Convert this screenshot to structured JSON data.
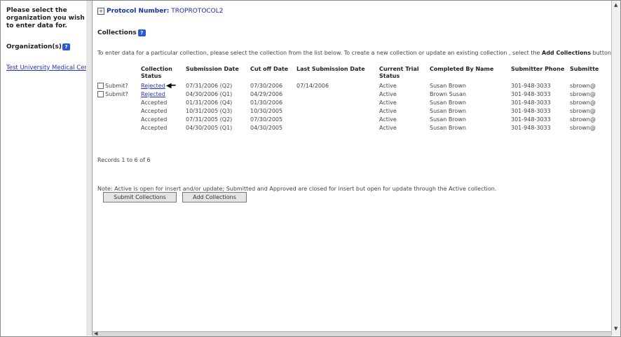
{
  "left": {
    "prompt": "Please select the organization you wish to enter data for.",
    "orgs_label": "Organization(s)",
    "org_link": "Test University Medical Cent"
  },
  "header": {
    "protocol_label": "Protocol Number:",
    "protocol_value": "TROPROTOCOL2",
    "collections_title": "Collections",
    "instructions_pre": "To enter data for a particular collection, please select the collection from the list below. To create a new collection or update an existing collection , select the",
    "instructions_bold": "Add Collections",
    "instructions_post": "button"
  },
  "table": {
    "headers": [
      "",
      "Collection Status",
      "Submission Date",
      "Cut off Date",
      "Last Submission Date",
      "Current Trial Status",
      "Completed By Name",
      "Submitter Phone",
      "Submitte"
    ],
    "rows": [
      {
        "submit": "Submit?",
        "status": "Rejected",
        "submission": "07/31/2006 (Q2)",
        "cutoff": "07/30/2006",
        "last": "07/14/2006",
        "trial": "Active",
        "completed": "Susan Brown",
        "phone": "301-948-3033",
        "email": "sbrown@"
      },
      {
        "submit": "Submit?",
        "status": "Rejected",
        "submission": "04/30/2006 (Q1)",
        "cutoff": "04/29/2006",
        "last": "",
        "trial": "Active",
        "completed": "Brown Susan",
        "phone": "301-948-3033",
        "email": "sbrown@"
      },
      {
        "submit": "",
        "status": "Accepted",
        "submission": "01/31/2006 (Q4)",
        "cutoff": "01/30/2006",
        "last": "",
        "trial": "Active",
        "completed": "Susan Brown",
        "phone": "301-948-3033",
        "email": "sbrown@"
      },
      {
        "submit": "",
        "status": "Accepted",
        "submission": "10/31/2005 (Q3)",
        "cutoff": "10/30/2005",
        "last": "",
        "trial": "Active",
        "completed": "Susan Brown",
        "phone": "301-948-3033",
        "email": "sbrown@"
      },
      {
        "submit": "",
        "status": "Accepted",
        "submission": "07/31/2005 (Q2)",
        "cutoff": "07/30/2005",
        "last": "",
        "trial": "Active",
        "completed": "Susan Brown",
        "phone": "301-948-3033",
        "email": "sbrown@"
      },
      {
        "submit": "",
        "status": "Accepted",
        "submission": "04/30/2005 (Q1)",
        "cutoff": "04/30/2005",
        "last": "",
        "trial": "Active",
        "completed": "Susan Brown",
        "phone": "301-948-3033",
        "email": "sbrown@"
      }
    ]
  },
  "records": "Records 1 to 6 of 6",
  "note": "Note: Active is open for insert and/or update; Submitted and Approved are closed for insert but open for update through the Active collection.",
  "buttons": {
    "submit": "Submit Collections",
    "add": "Add Collections"
  }
}
